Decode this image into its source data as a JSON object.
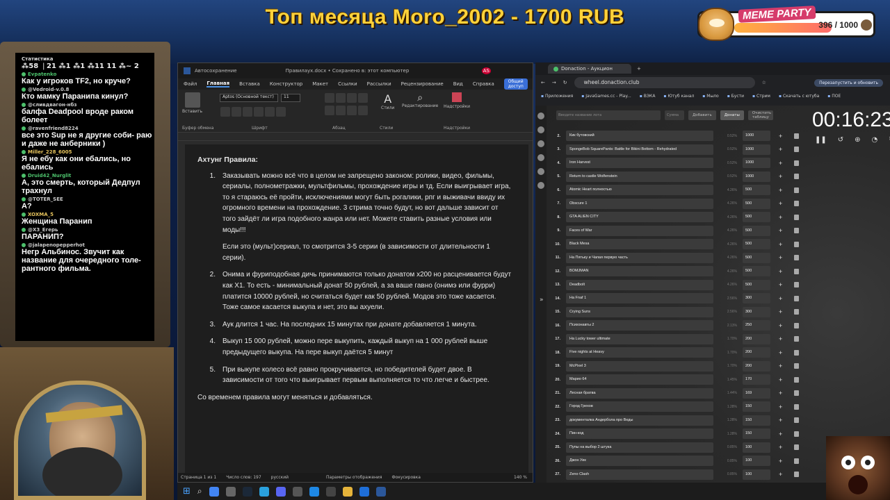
{
  "stream": {
    "title": "Топ месяца Moro_2002 - 1700 RUB",
    "meme_party": {
      "label": "MEME PARTY",
      "count": "396 / 1000"
    }
  },
  "chat": {
    "stats_title": "Статистика",
    "stats_line": "⁂58 ❘21 ⁂1 ⁂1 ⁂11 11 ⁂~ 2",
    "messages": [
      {
        "user": "Evpatenko",
        "color": "#4cc06b",
        "text": "Как у игроков TF2, но круче?"
      },
      {
        "user": "@Vedroid-v.0.8",
        "color": "#cccccc",
        "text": "Кто мамку Паранипа кинул?"
      },
      {
        "user": "@сливдвагон-нбз",
        "color": "#cccccc",
        "text": "балфа Deadpool вроде раком болеет"
      },
      {
        "user": "@ravenfriend8224",
        "color": "#cccccc",
        "text": "все это Sup не я другие соби- раю и даже не анберники )"
      },
      {
        "user": "Miller_228_6005",
        "color": "#e6c35c",
        "text": "Я не ебу как они ебались, но ебались"
      },
      {
        "user": "Druid42_Nurglit",
        "color": "#4cc06b",
        "text": "А, это смерть, который Дедпул трахнул"
      },
      {
        "user": "@TOTER_SEE",
        "color": "#cccccc",
        "text": "А?"
      },
      {
        "user": "XOXMA_5",
        "color": "#e6c35c",
        "text": "Женщина Паранип"
      },
      {
        "user": "@X3_Егерь",
        "color": "#cccccc",
        "text": "ПАРАНИП?"
      },
      {
        "user": "@jalapenopepperhot",
        "color": "#cccccc",
        "text": "Негр Альбинос. Звучит как название для очередного толе- рантного фильма."
      }
    ]
  },
  "word": {
    "autosave": "Автосохранение",
    "doc_title": "Правилаух.docx • Сохранено в: этот компьютер",
    "user_initials": "AS",
    "menu": [
      "Файл",
      "Главная",
      "Вставка",
      "Конструктор",
      "Макет",
      "Ссылки",
      "Рассылки",
      "Рецензирование",
      "Вид",
      "Справка"
    ],
    "active_menu": "Главная",
    "share": "Общий доступ",
    "ribbon": {
      "paste": "Вставить",
      "font": "Aptos (Основной текст)",
      "size": "11",
      "styles": "Стили",
      "editing": "Редактирование",
      "addins": "Надстройки",
      "groups": [
        "Буфер обмена",
        "Шрифт",
        "Абзац",
        "Стили",
        "Надстройки"
      ]
    },
    "heading": "Ахтунг Правила:",
    "rules": [
      {
        "num": "1.",
        "text": "Заказывать можно всё что в целом не запрещено законом: ролики, видео, фильмы, сериалы, полнометражки, мультфильмы, прохождение игры и тд. Если выигрывает игра, то я стараюсь её пройти, исключениями могут быть рогалики, рпг и выживачи ввиду их огромного времени на прохождение. 3 стрима точно будут, но вот дальше зависит от того зайдёт ли игра подобного жанра или нет. Можете ставить разные условия или моды!!!"
      },
      {
        "num": "",
        "text": "Если это (мульт)сериал, то смотрится 3-5 серии (в зависимости от длительности 1 серии)."
      },
      {
        "num": "2.",
        "text": "Онима и фуриподобная дичь принимаются только донатом x200 но расценивается будут как X1. То есть - минимальный донат 50 рублей, а за ваше гавно (онимэ или фурри) платится 10000 рублей, но считаться будет как 50 рублей. Модов это тоже касается. Тоже самое касается выкупа и нет, это вы ахуели."
      },
      {
        "num": "3.",
        "text": "Аук длится 1 час. На последних 15 минутах при донате добавляется 1 минута."
      },
      {
        "num": "4.",
        "text": "Выкуп 15 000 рублей, можно пере выкупить, каждый выкуп на 1 000 рублей выше предыдущего выкупа. На пере выкуп даётся 5 минут"
      },
      {
        "num": "5.",
        "text": "При выкупе колесо всё равно прокручивается, но победителей будет двое. В зависимости от того что выигрывает первым выполняется то что легче и быстрее."
      }
    ],
    "footer_note": "Со временем правила могут меняться и добавляться.",
    "status": {
      "page": "Страница 1 из 1",
      "words": "Число слов: 197",
      "lang": "русский",
      "display": "Параметры отображения",
      "focus": "Фокусировка",
      "zoom": "140 %"
    }
  },
  "browser": {
    "tab_title": "Donaction - Аукцион",
    "url": "wheel.donaction.club",
    "relaunch": "Перезапустить и обновить",
    "bookmarks": [
      "Приложения",
      "JavaGames.cc - Play...",
      "ВЭКА",
      "Ютуб канал",
      "Мыло",
      "Бусти",
      "Стрим",
      "Скачать с ютуба",
      "ПОЕ"
    ],
    "controls": {
      "name_placeholder": "Введите название лота",
      "amount_placeholder": "Сумма",
      "add": "Добавить",
      "donate": "Донаты",
      "clear": "Очистить таблицу"
    },
    "timer": "00:16:23",
    "lots": [
      {
        "idx": "2.",
        "name": "Кик бутовский",
        "pct": "0.52%",
        "amount": "1000"
      },
      {
        "idx": "3.",
        "name": "SpongeBob SquarePants: Battle for Bikini Bottom - Rehydrated",
        "pct": "0.52%",
        "amount": "1000"
      },
      {
        "idx": "4.",
        "name": "Iron Harvest",
        "pct": "0.52%",
        "amount": "1000"
      },
      {
        "idx": "5.",
        "name": "Return to castle Wolfenstein",
        "pct": "0.52%",
        "amount": "1000"
      },
      {
        "idx": "6.",
        "name": "Atomic Heart полностью",
        "pct": "4.26%",
        "amount": "500"
      },
      {
        "idx": "7.",
        "name": "Obscure 1",
        "pct": "4.26%",
        "amount": "500"
      },
      {
        "idx": "8.",
        "name": "GTA ALIEN CITY",
        "pct": "4.26%",
        "amount": "500"
      },
      {
        "idx": "9.",
        "name": "Faces of War",
        "pct": "4.26%",
        "amount": "500"
      },
      {
        "idx": "10.",
        "name": "Black Mesa",
        "pct": "4.26%",
        "amount": "500"
      },
      {
        "idx": "11.",
        "name": "На Пятьку и Чапая первую часть",
        "pct": "4.26%",
        "amount": "500"
      },
      {
        "idx": "12.",
        "name": "BOMJMAN",
        "pct": "4.26%",
        "amount": "500"
      },
      {
        "idx": "13.",
        "name": "Deadbolt",
        "pct": "4.26%",
        "amount": "500"
      },
      {
        "idx": "14.",
        "name": "На Fnaf 1",
        "pct": "2.56%",
        "amount": "300"
      },
      {
        "idx": "15.",
        "name": "Crying Suns",
        "pct": "2.56%",
        "amount": "300"
      },
      {
        "idx": "16.",
        "name": "Психонавты 2",
        "pct": "2.13%",
        "amount": "250"
      },
      {
        "idx": "17.",
        "name": "На Lucky tower ultimate",
        "pct": "1.70%",
        "amount": "200"
      },
      {
        "idx": "18.",
        "name": "Five nights at Heavy",
        "pct": "1.70%",
        "amount": "200"
      },
      {
        "idx": "19.",
        "name": "McPixel 3",
        "pct": "1.70%",
        "amount": "200"
      },
      {
        "idx": "20.",
        "name": "Марио 64",
        "pct": "1.45%",
        "amount": "170"
      },
      {
        "idx": "21.",
        "name": "Лесная братва",
        "pct": "1.44%",
        "amount": "169"
      },
      {
        "idx": "22.",
        "name": "Город Грехов",
        "pct": "1.28%",
        "amount": "150"
      },
      {
        "idx": "23.",
        "name": "документалка Андербола про Веды",
        "pct": "1.28%",
        "amount": "150"
      },
      {
        "idx": "24.",
        "name": "Пин-код",
        "pct": "1.28%",
        "amount": "150"
      },
      {
        "idx": "25.",
        "name": "Пупы на выбор 2 штука",
        "pct": "0.85%",
        "amount": "100"
      },
      {
        "idx": "26.",
        "name": "Джон Уик",
        "pct": "0.85%",
        "amount": "100"
      },
      {
        "idx": "27.",
        "name": "Zeno Clash",
        "pct": "0.85%",
        "amount": "100"
      }
    ]
  }
}
